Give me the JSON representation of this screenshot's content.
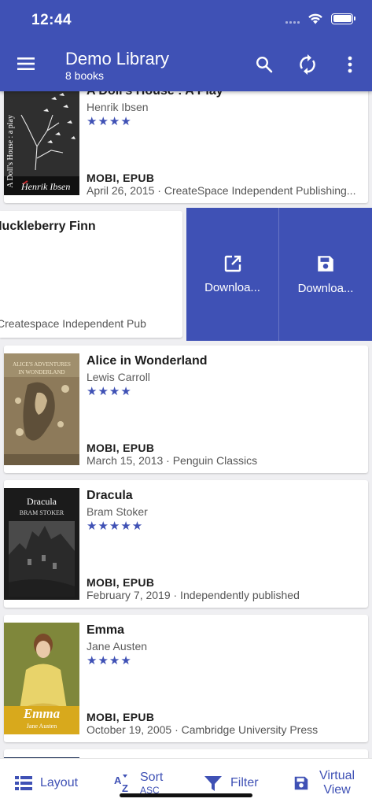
{
  "status_bar": {
    "time": "12:44"
  },
  "app_bar": {
    "title": "Demo Library",
    "subtitle": "8 books",
    "icons": [
      "menu-icon",
      "search-icon",
      "sync-icon",
      "more-vert-icon"
    ]
  },
  "colors": {
    "primary": "#3f51b5",
    "background": "#efeff2"
  },
  "books": [
    {
      "title": "A Doll's House : A Play",
      "author": "Henrik Ibsen",
      "rating": 4,
      "stars": "★★★★",
      "formats": "MOBI, EPUB",
      "pubinfo": "April 26, 2015 · CreateSpace Independent Publishing...",
      "cover_title": "A Doll's House : a play",
      "cover_author": "Henrik Ibsen"
    },
    {
      "title": "Huckleberry Finn",
      "pubinfo": "Createspace Independent Pub"
    },
    {
      "title": "Alice in Wonderland",
      "author": "Lewis Carroll",
      "rating": 4,
      "stars": "★★★★",
      "formats": "MOBI, EPUB",
      "pubinfo": "March 15, 2013 · Penguin Classics"
    },
    {
      "title": "Dracula",
      "author": "Bram Stoker",
      "rating": 5,
      "stars": "★★★★★",
      "formats": "MOBI, EPUB",
      "pubinfo": "February 7, 2019 · Independently published",
      "cover_title": "Dracula",
      "cover_author": "BRAM STOKER"
    },
    {
      "title": "Emma",
      "author": "Jane Austen",
      "rating": 4,
      "stars": "★★★★",
      "formats": "MOBI, EPUB",
      "pubinfo": "October 19, 2005 · Cambridge University Press",
      "cover_title": "Emma",
      "cover_author": "Jane Austen"
    }
  ],
  "swipe_actions": [
    {
      "label": "Downloa...",
      "icon": "open-in-new-icon"
    },
    {
      "label": "Downloa...",
      "icon": "save-icon"
    }
  ],
  "bottom_bar": {
    "layout": "Layout",
    "sort": "Sort",
    "sort_sub": "ASC",
    "filter": "Filter",
    "virtual": "Virtual",
    "virtual_sub": "View"
  }
}
